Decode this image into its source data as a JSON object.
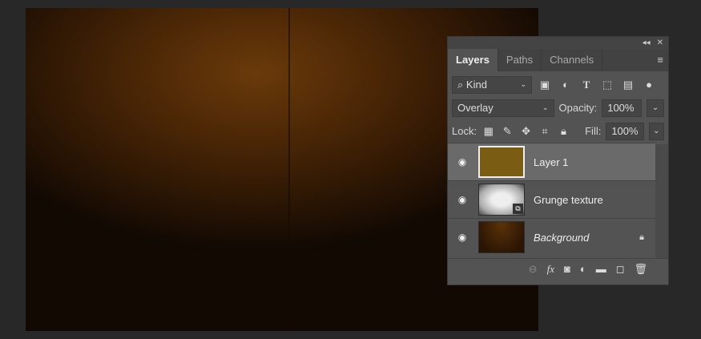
{
  "panel": {
    "tabs": [
      "Layers",
      "Paths",
      "Channels"
    ],
    "collapse_icon": "double-chevron",
    "close_icon": "x",
    "filter": {
      "label": "Kind"
    },
    "blend_mode": "Overlay",
    "opacity_label": "Opacity:",
    "opacity": "100%",
    "lock_label": "Lock:",
    "fill_label": "Fill:",
    "fill": "100%",
    "layers": [
      {
        "name": "Layer 1",
        "color": "#7a5c12"
      },
      {
        "name": "Grunge texture"
      },
      {
        "name": "Background"
      }
    ]
  }
}
